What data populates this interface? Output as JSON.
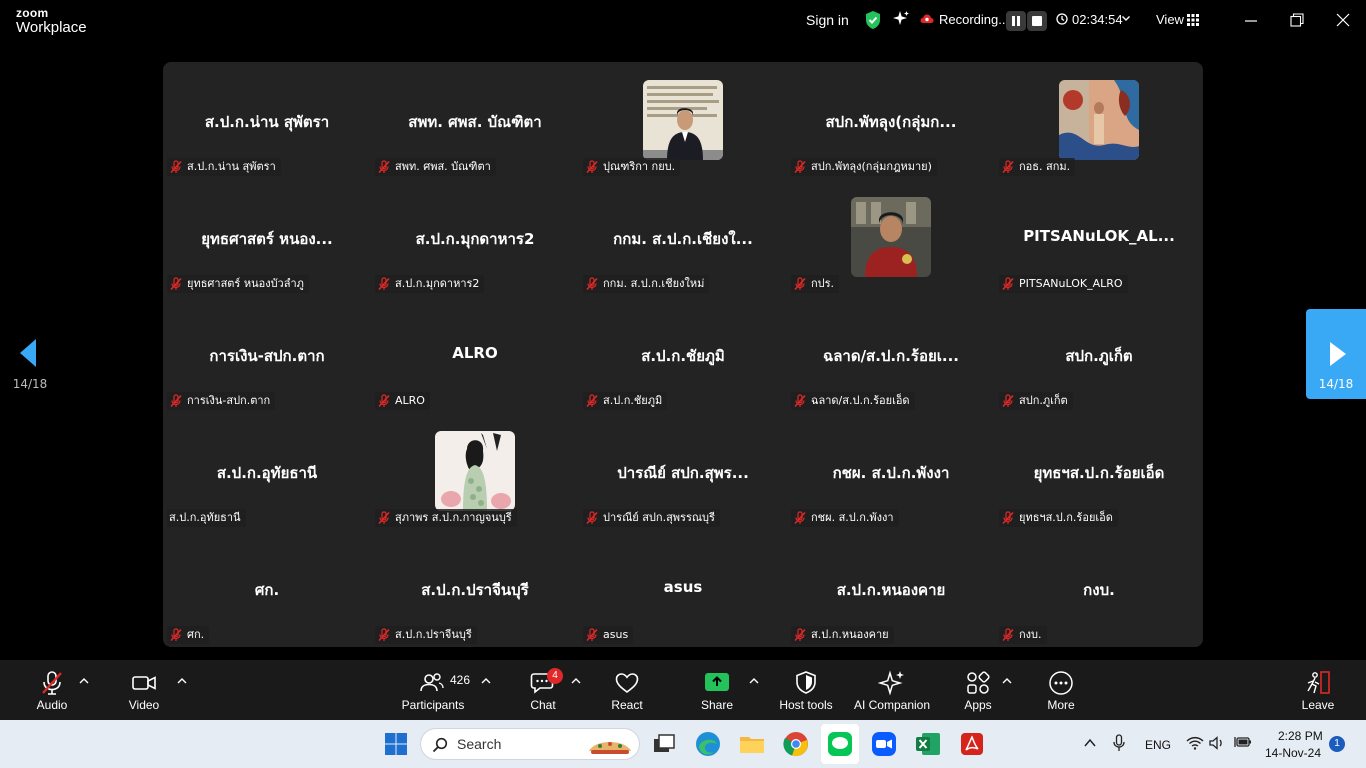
{
  "app": {
    "brand_top": "zoom",
    "brand_bottom": "Workplace"
  },
  "titlebar": {
    "sign_in": "Sign in",
    "recording": "Recording...",
    "timer": "02:34:54",
    "view": "View"
  },
  "gallery": {
    "tiles": [
      {
        "name": "ส.ป.ก.น่าน สุพัตรา",
        "label": "ส.ป.ก.น่าน สุพัตรา",
        "muted": true,
        "video": false
      },
      {
        "name": "สพท. ศพส. บัณฑิตา",
        "label": "สพท. ศพส. บัณฑิตา",
        "muted": true,
        "video": false
      },
      {
        "name": "",
        "label": "ปุณฑริกา กยบ.",
        "muted": true,
        "video": true
      },
      {
        "name": "สปก.พัทลุง(กลุ่มก...",
        "label": "สปก.พัทลุง(กลุ่มกฎหมาย)",
        "muted": true,
        "video": false
      },
      {
        "name": "",
        "label": "กอธ. สกม.",
        "muted": true,
        "video": true
      },
      {
        "name": "ยุทธศาสตร์ หนอง...",
        "label": "ยุทธศาสตร์ หนองบัวลำภู",
        "muted": true,
        "video": false
      },
      {
        "name": "ส.ป.ก.มุกดาหาร2",
        "label": "ส.ป.ก.มุกดาหาร2",
        "muted": true,
        "video": false
      },
      {
        "name": "กกม. ส.ป.ก.เชียงใ...",
        "label": "กกม. ส.ป.ก.เชียงใหม่",
        "muted": true,
        "video": false
      },
      {
        "name": "",
        "label": "กปร.",
        "muted": true,
        "video": true
      },
      {
        "name": "PITSANuLOK_AL...",
        "label": "PITSANuLOK_ALRO",
        "muted": true,
        "video": false
      },
      {
        "name": "การเงิน-สปก.ตาก",
        "label": "การเงิน-สปก.ตาก",
        "muted": true,
        "video": false
      },
      {
        "name": "ALRO",
        "label": "ALRO",
        "muted": true,
        "video": false
      },
      {
        "name": "ส.ป.ก.ชัยภูมิ",
        "label": "ส.ป.ก.ชัยภูมิ",
        "muted": true,
        "video": false
      },
      {
        "name": "ฉลาด/ส.ป.ก.ร้อยเ...",
        "label": "ฉลาด/ส.ป.ก.ร้อยเอ็ด",
        "muted": true,
        "video": false
      },
      {
        "name": "สปก.ภูเก็ต",
        "label": "สปก.ภูเก็ต",
        "muted": true,
        "video": false
      },
      {
        "name": "ส.ป.ก.อุทัยธานี",
        "label": "ส.ป.ก.อุทัยธานี",
        "muted": false,
        "video": false
      },
      {
        "name": "",
        "label": "สุภาพร ส.ป.ก.กาญจนบุรี",
        "muted": true,
        "video": true
      },
      {
        "name": "ปารณีย์ สปก.สุพร...",
        "label": "ปารณีย์ สปก.สุพรรณบุรี",
        "muted": true,
        "video": false
      },
      {
        "name": "กชผ. ส.ป.ก.พังงา",
        "label": "กชผ. ส.ป.ก.พังงา",
        "muted": true,
        "video": false
      },
      {
        "name": "ยุทธฯส.ป.ก.ร้อยเอ็ด",
        "label": "ยุทธฯส.ป.ก.ร้อยเอ็ด",
        "muted": true,
        "video": false
      },
      {
        "name": "ศก.",
        "label": "ศก.",
        "muted": true,
        "video": false
      },
      {
        "name": "ส.ป.ก.ปราจีนบุรี",
        "label": "ส.ป.ก.ปราจีนบุรี",
        "muted": true,
        "video": false
      },
      {
        "name": "asus",
        "label": "asus",
        "muted": true,
        "video": false
      },
      {
        "name": "ส.ป.ก.หนองคาย",
        "label": "ส.ป.ก.หนองคาย",
        "muted": true,
        "video": false
      },
      {
        "name": "กงบ.",
        "label": "กงบ.",
        "muted": true,
        "video": false
      }
    ]
  },
  "nav": {
    "prev_page": "14/18",
    "next_page": "14/18"
  },
  "toolbar": {
    "audio": "Audio",
    "video": "Video",
    "participants": "Participants",
    "participants_count": "426",
    "chat": "Chat",
    "chat_badge": "4",
    "react": "React",
    "share": "Share",
    "host_tools": "Host tools",
    "ai_companion": "AI Companion",
    "apps": "Apps",
    "more": "More",
    "leave": "Leave"
  },
  "taskbar": {
    "search_placeholder": "Search",
    "language": "ENG",
    "time": "2:28 PM",
    "date": "14-Nov-24",
    "notifications": "1"
  },
  "colors": {
    "accent": "#3aa9f5",
    "muted_red": "#e02828",
    "share_green": "#23c25b",
    "gallery_bg": "#232323"
  }
}
